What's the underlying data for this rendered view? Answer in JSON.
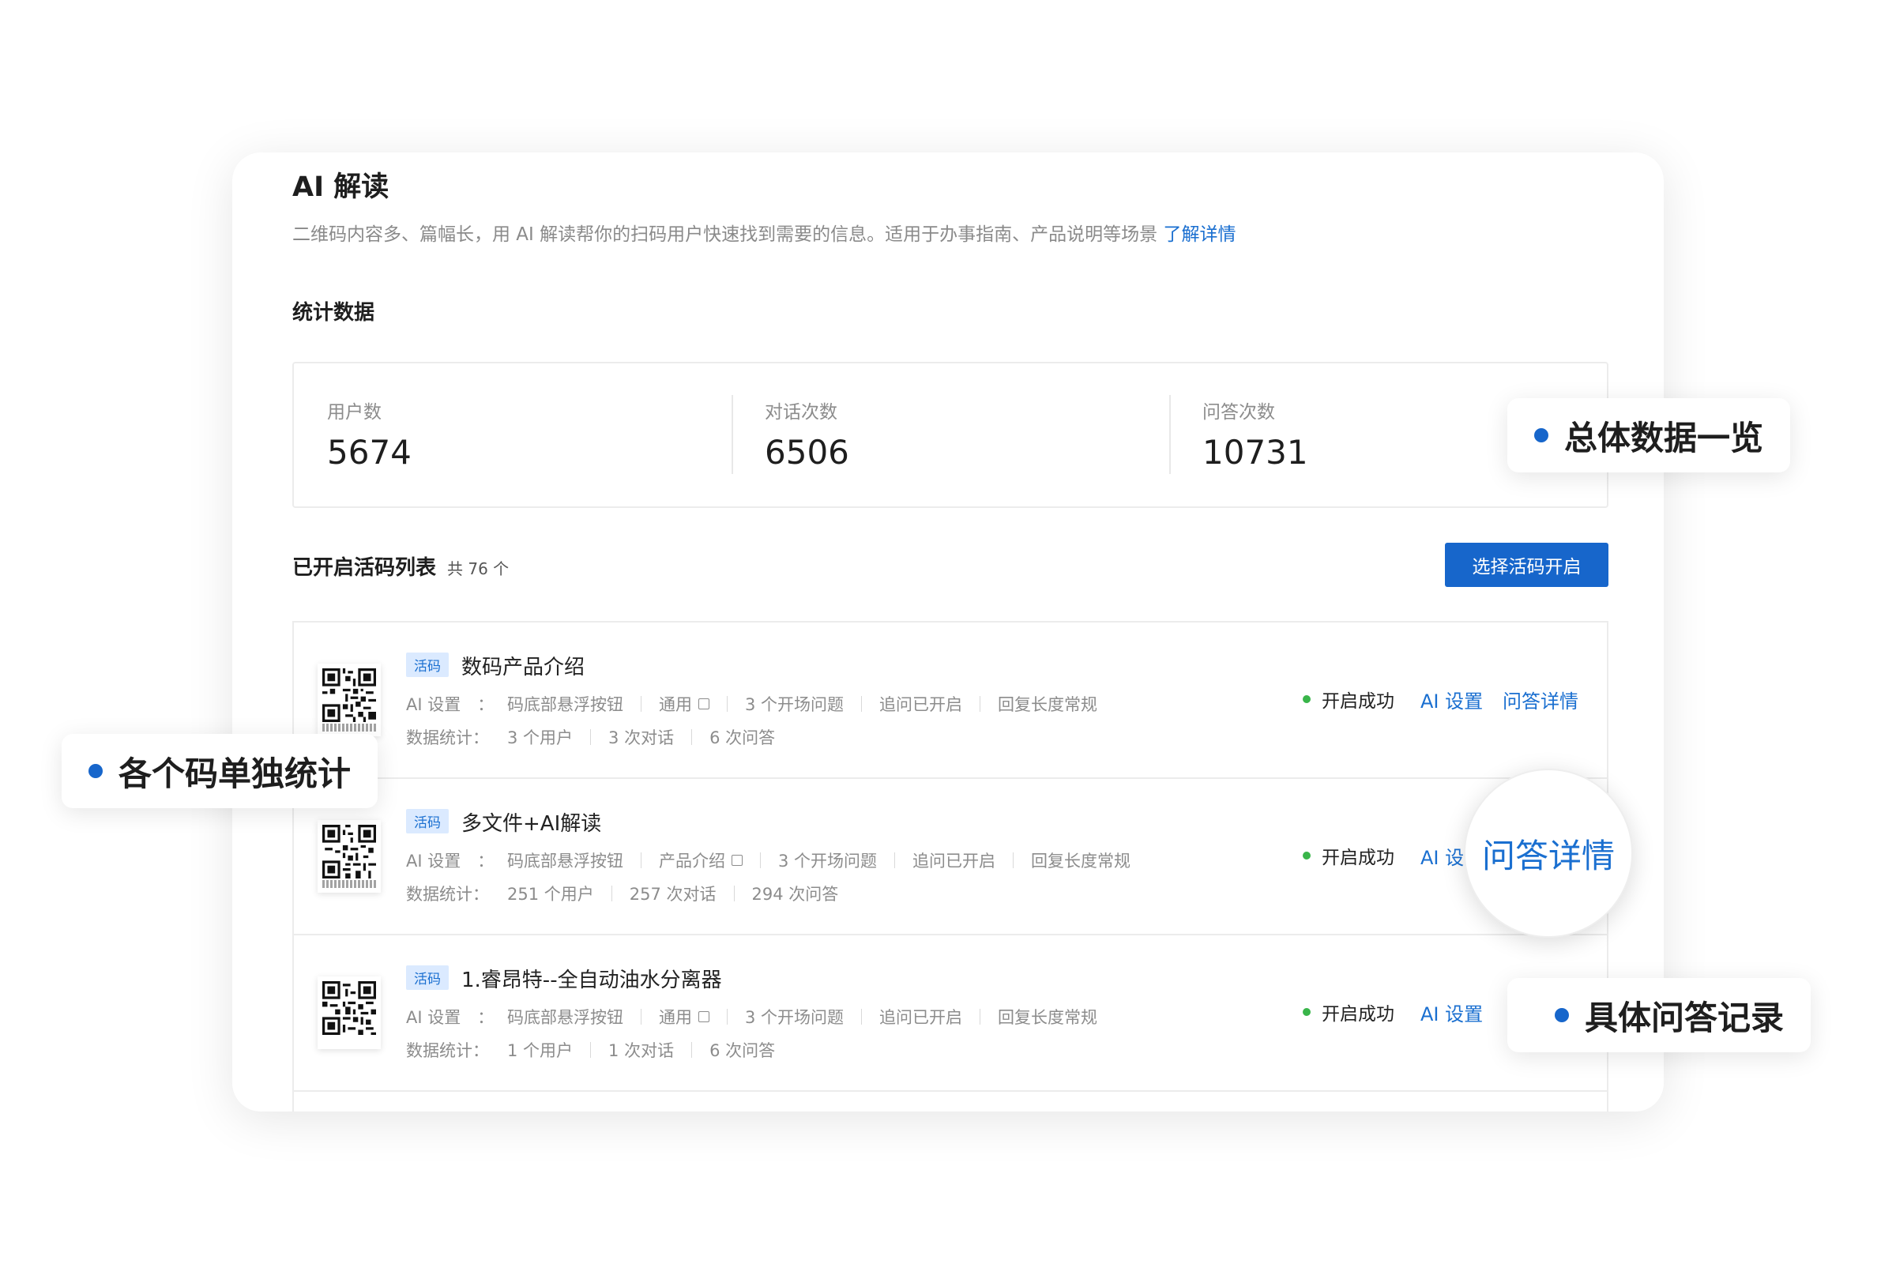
{
  "header": {
    "title": "AI 解读",
    "description": "二维码内容多、篇幅长，用 AI 解读帮你的扫码用户快速找到需要的信息。适用于办事指南、产品说明等场景",
    "learn_more": "了解详情"
  },
  "stats_section": {
    "title": "统计数据",
    "items": [
      {
        "label": "用户数",
        "value": "5674"
      },
      {
        "label": "对话次数",
        "value": "6506"
      },
      {
        "label": "问答次数",
        "value": "10731"
      }
    ]
  },
  "list_section": {
    "title": "已开启活码列表",
    "count": "共 76 个",
    "button": "选择活码开启"
  },
  "rows": [
    {
      "tag": "活码",
      "name": "数码产品介绍",
      "ai_key": "AI 设置　：",
      "ai_button": "码底部悬浮按钮",
      "ai_scope": "通用",
      "ai_questions": "3 个开场问题",
      "ai_followup": "追问已开启",
      "ai_length": "回复长度常规",
      "stats_key": "数据统计：",
      "users": "3 个用户",
      "chats": "3 次对话",
      "qas": "6 次问答",
      "status": "开启成功",
      "action1": "AI 设置",
      "action2": "问答详情"
    },
    {
      "tag": "活码",
      "name": "多文件+AI解读",
      "ai_key": "AI 设置　：",
      "ai_button": "码底部悬浮按钮",
      "ai_scope": "产品介绍",
      "ai_questions": "3 个开场问题",
      "ai_followup": "追问已开启",
      "ai_length": "回复长度常规",
      "stats_key": "数据统计：",
      "users": "251 个用户",
      "chats": "257 次对话",
      "qas": "294 次问答",
      "status": "开启成功",
      "action1": "AI 设",
      "action2": ""
    },
    {
      "tag": "活码",
      "name": "1.睿昂特--全自动油水分离器",
      "ai_key": "AI 设置　：",
      "ai_button": "码底部悬浮按钮",
      "ai_scope": "通用",
      "ai_questions": "3 个开场问题",
      "ai_followup": "追问已开启",
      "ai_length": "回复长度常规",
      "stats_key": "数据统计：",
      "users": "1 个用户",
      "chats": "1 次对话",
      "qas": "6 次问答",
      "status": "开启成功",
      "action1": "AI 设置",
      "action2": ""
    }
  ],
  "callouts": {
    "overview": "总体数据一览",
    "per_code": "各个码单独统计",
    "records": "具体问答记录",
    "magnified": "问答详情"
  },
  "colors": {
    "accent": "#1766cb",
    "link": "#1a6fd0",
    "status_green": "#39b54a",
    "tag_bg": "#dbeaff"
  }
}
